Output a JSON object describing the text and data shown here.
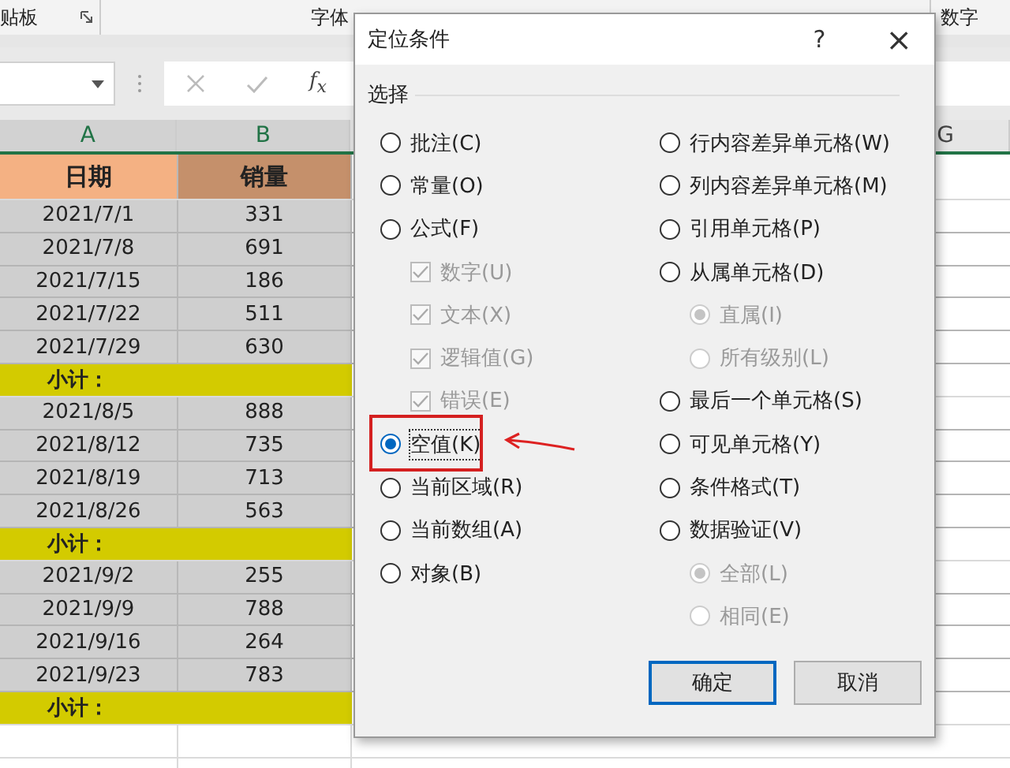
{
  "ribbon": {
    "groups": [
      {
        "label": "贴板",
        "launcher": true
      },
      {
        "label": "字体",
        "launcher": false
      },
      {
        "label": "数字",
        "launcher": false
      }
    ]
  },
  "formula_bar": {
    "function_button": "f$_{x}$"
  },
  "sheet": {
    "columns": [
      "A",
      "B",
      "G"
    ],
    "rows": [
      {
        "kind": "header",
        "cells": [
          "日期",
          "销量"
        ]
      },
      {
        "kind": "data",
        "cells": [
          "2021/7/1",
          "331"
        ]
      },
      {
        "kind": "data",
        "cells": [
          "2021/7/8",
          "691"
        ]
      },
      {
        "kind": "data",
        "cells": [
          "2021/7/15",
          "186"
        ]
      },
      {
        "kind": "data",
        "cells": [
          "2021/7/22",
          "511"
        ]
      },
      {
        "kind": "data",
        "cells": [
          "2021/7/29",
          "630"
        ]
      },
      {
        "kind": "subtotal",
        "cells": [
          "小计："
        ]
      },
      {
        "kind": "data",
        "cells": [
          "2021/8/5",
          "888"
        ]
      },
      {
        "kind": "data",
        "cells": [
          "2021/8/12",
          "735"
        ]
      },
      {
        "kind": "data",
        "cells": [
          "2021/8/19",
          "713"
        ]
      },
      {
        "kind": "data",
        "cells": [
          "2021/8/26",
          "563"
        ]
      },
      {
        "kind": "subtotal",
        "cells": [
          "小计："
        ]
      },
      {
        "kind": "data",
        "cells": [
          "2021/9/2",
          "255"
        ]
      },
      {
        "kind": "data",
        "cells": [
          "2021/9/9",
          "788"
        ]
      },
      {
        "kind": "data",
        "cells": [
          "2021/9/16",
          "264"
        ]
      },
      {
        "kind": "data",
        "cells": [
          "2021/9/23",
          "783"
        ]
      },
      {
        "kind": "subtotal",
        "cells": [
          "小计："
        ]
      }
    ]
  },
  "dialog": {
    "title": "定位条件",
    "help": "?",
    "close": "×",
    "group_label": "选择",
    "left_options": [
      {
        "kind": "radio",
        "label": "批注(C)",
        "selected": false,
        "disabled": false,
        "highlighted": false
      },
      {
        "kind": "radio",
        "label": "常量(O)",
        "selected": false,
        "disabled": false,
        "highlighted": false
      },
      {
        "kind": "radio",
        "label": "公式(F)",
        "selected": false,
        "disabled": false,
        "highlighted": false
      },
      {
        "kind": "checkbox",
        "label": "数字(U)",
        "selected": true,
        "disabled": true,
        "highlighted": false
      },
      {
        "kind": "checkbox",
        "label": "文本(X)",
        "selected": true,
        "disabled": true,
        "highlighted": false
      },
      {
        "kind": "checkbox",
        "label": "逻辑值(G)",
        "selected": true,
        "disabled": true,
        "highlighted": false
      },
      {
        "kind": "checkbox",
        "label": "错误(E)",
        "selected": true,
        "disabled": true,
        "highlighted": false
      },
      {
        "kind": "radio",
        "label": "空值(K)",
        "selected": true,
        "disabled": false,
        "highlighted": true
      },
      {
        "kind": "radio",
        "label": "当前区域(R)",
        "selected": false,
        "disabled": false,
        "highlighted": false
      },
      {
        "kind": "radio",
        "label": "当前数组(A)",
        "selected": false,
        "disabled": false,
        "highlighted": false
      },
      {
        "kind": "radio",
        "label": "对象(B)",
        "selected": false,
        "disabled": false,
        "highlighted": false
      }
    ],
    "right_options": [
      {
        "kind": "radio",
        "label": "行内容差异单元格(W)",
        "selected": false,
        "disabled": false
      },
      {
        "kind": "radio",
        "label": "列内容差异单元格(M)",
        "selected": false,
        "disabled": false
      },
      {
        "kind": "radio",
        "label": "引用单元格(P)",
        "selected": false,
        "disabled": false
      },
      {
        "kind": "radio",
        "label": "从属单元格(D)",
        "selected": false,
        "disabled": false
      },
      {
        "kind": "subradio",
        "label": "直属(I)",
        "selected": true,
        "disabled": true
      },
      {
        "kind": "subradio",
        "label": "所有级别(L)",
        "selected": false,
        "disabled": true
      },
      {
        "kind": "radio",
        "label": "最后一个单元格(S)",
        "selected": false,
        "disabled": false
      },
      {
        "kind": "radio",
        "label": "可见单元格(Y)",
        "selected": false,
        "disabled": false
      },
      {
        "kind": "radio",
        "label": "条件格式(T)",
        "selected": false,
        "disabled": false
      },
      {
        "kind": "radio",
        "label": "数据验证(V)",
        "selected": false,
        "disabled": false
      },
      {
        "kind": "subradio",
        "label": "全部(L)",
        "selected": true,
        "disabled": true
      },
      {
        "kind": "subradio",
        "label": "相同(E)",
        "selected": false,
        "disabled": true
      }
    ],
    "buttons": [
      {
        "label": "确定",
        "default": true
      },
      {
        "label": "取消",
        "default": false
      }
    ]
  }
}
